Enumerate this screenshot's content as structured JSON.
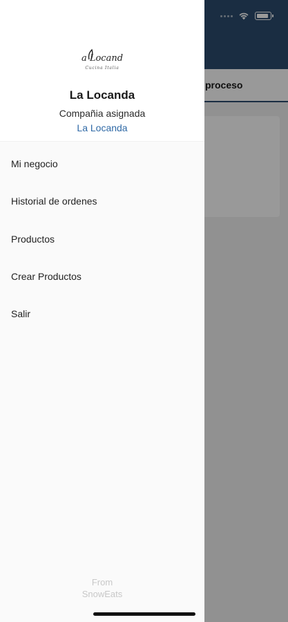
{
  "background_app": {
    "header_color": "#2c4c6e",
    "tab_label": "proceso"
  },
  "drawer": {
    "logo": {
      "title": "a Locand",
      "subtitle": "Cucina Italia"
    },
    "restaurant_name": "La Locanda",
    "assigned_label": "Compañia asignada",
    "assigned_company": "La Locanda",
    "menu": [
      {
        "label": "Mi negocio"
      },
      {
        "label": "Historial de ordenes"
      },
      {
        "label": "Productos"
      },
      {
        "label": "Crear Productos"
      },
      {
        "label": "Salir"
      }
    ],
    "footer": {
      "from": "From",
      "brand": "SnowEats"
    }
  },
  "colors": {
    "accent": "#2f69a6",
    "header": "#2c4c6e",
    "drawer_bg": "#fafafa"
  }
}
